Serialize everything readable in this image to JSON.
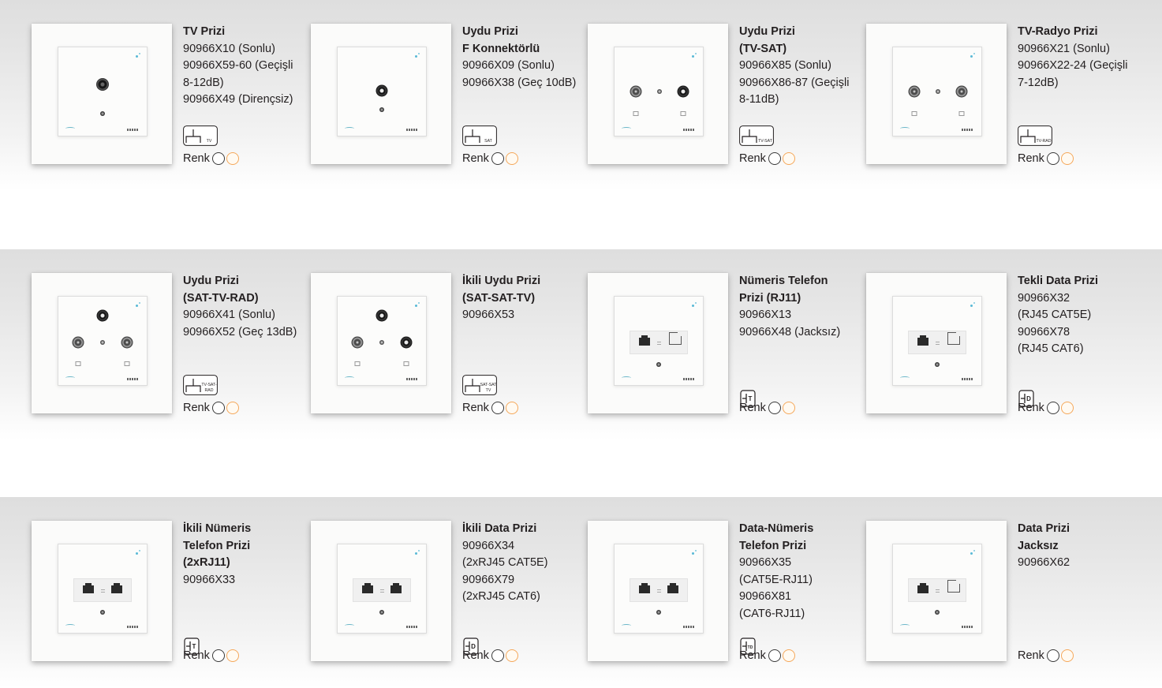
{
  "colors": {
    "text": "#231f20",
    "band": "#e2e2e2",
    "renk_white_border": "#3a3a3a",
    "renk_cream_border": "#f5a85a",
    "led_accent": "#59b9d6"
  },
  "renk_label": "Renk",
  "rows": [
    {
      "products": [
        {
          "title": [
            "TV Prizi"
          ],
          "codes": [
            "90966X10 (Sonlu)",
            "90966X59-60 (Geçişli",
            "8-12dB)",
            "90966X49 (Dirençsiz)"
          ],
          "symbol_label": [
            "TV"
          ],
          "photo": "tv-single"
        },
        {
          "title": [
            "Uydu Prizi",
            "F Konnektörlü"
          ],
          "codes": [
            "90966X09 (Sonlu)",
            "90966X38 (Geç 10dB)"
          ],
          "symbol_label": [
            "SAT"
          ],
          "photo": "f-single"
        },
        {
          "title": [
            "Uydu Prizi",
            "(TV-SAT)"
          ],
          "codes": [
            "90966X85 (Sonlu)",
            "90966X86-87 (Geçişli",
            "8-11dB)"
          ],
          "symbol_label": [
            "TV-SAT"
          ],
          "photo": "tv-sat"
        },
        {
          "title": [
            "TV-Radyo Prizi"
          ],
          "codes": [
            "90966X21 (Sonlu)",
            "90966X22-24 (Geçişli",
            "7-12dB)"
          ],
          "symbol_label": [
            "TV-RAD"
          ],
          "photo": "tv-rad"
        }
      ]
    },
    {
      "products": [
        {
          "title": [
            "Uydu Prizi",
            "(SAT-TV-RAD)"
          ],
          "codes": [
            "90966X41 (Sonlu)",
            "90966X52 (Geç 13dB)"
          ],
          "symbol_label": [
            "TV-SAT-",
            "RAD"
          ],
          "photo": "sat-tv-rad"
        },
        {
          "title": [
            "İkili Uydu Prizi",
            "(SAT-SAT-TV)"
          ],
          "codes": [
            "90966X53"
          ],
          "symbol_label": [
            "SAT-SAT",
            "TV"
          ],
          "photo": "sat-sat-tv"
        },
        {
          "title": [
            "Nümeris Telefon",
            "Prizi (RJ11)"
          ],
          "codes": [
            "90966X13",
            "90966X48 (Jacksız)"
          ],
          "symbol_label": [
            "T"
          ],
          "photo": "rj-single"
        },
        {
          "title": [
            "Tekli Data Prizi"
          ],
          "codes": [
            "90966X32",
            "(RJ45 CAT5E)",
            "90966X78",
            "(RJ45 CAT6)"
          ],
          "symbol_label": [
            "D"
          ],
          "photo": "rj-single"
        }
      ]
    },
    {
      "products": [
        {
          "title": [
            "İkili Nümeris",
            "Telefon Prizi",
            "(2xRJ11)"
          ],
          "codes": [
            "90966X33"
          ],
          "symbol_label": [
            "T"
          ],
          "photo": "rj-double"
        },
        {
          "title": [
            "İkili Data Prizi"
          ],
          "codes": [
            "90966X34",
            "(2xRJ45 CAT5E)",
            "90966X79",
            "(2xRJ45 CAT6)"
          ],
          "symbol_label": [
            "D"
          ],
          "photo": "rj-double"
        },
        {
          "title": [
            "Data-Nümeris",
            "Telefon Prizi"
          ],
          "codes": [
            "90966X35",
            "(CAT5E-RJ11)",
            "90966X81",
            "(CAT6-RJ11)"
          ],
          "symbol_label": [
            "TD"
          ],
          "photo": "rj-double"
        },
        {
          "title": [
            "Data Prizi",
            "Jacksız"
          ],
          "codes": [
            "90966X62"
          ],
          "symbol_label": [],
          "photo": "rj-empty-single"
        }
      ]
    }
  ]
}
